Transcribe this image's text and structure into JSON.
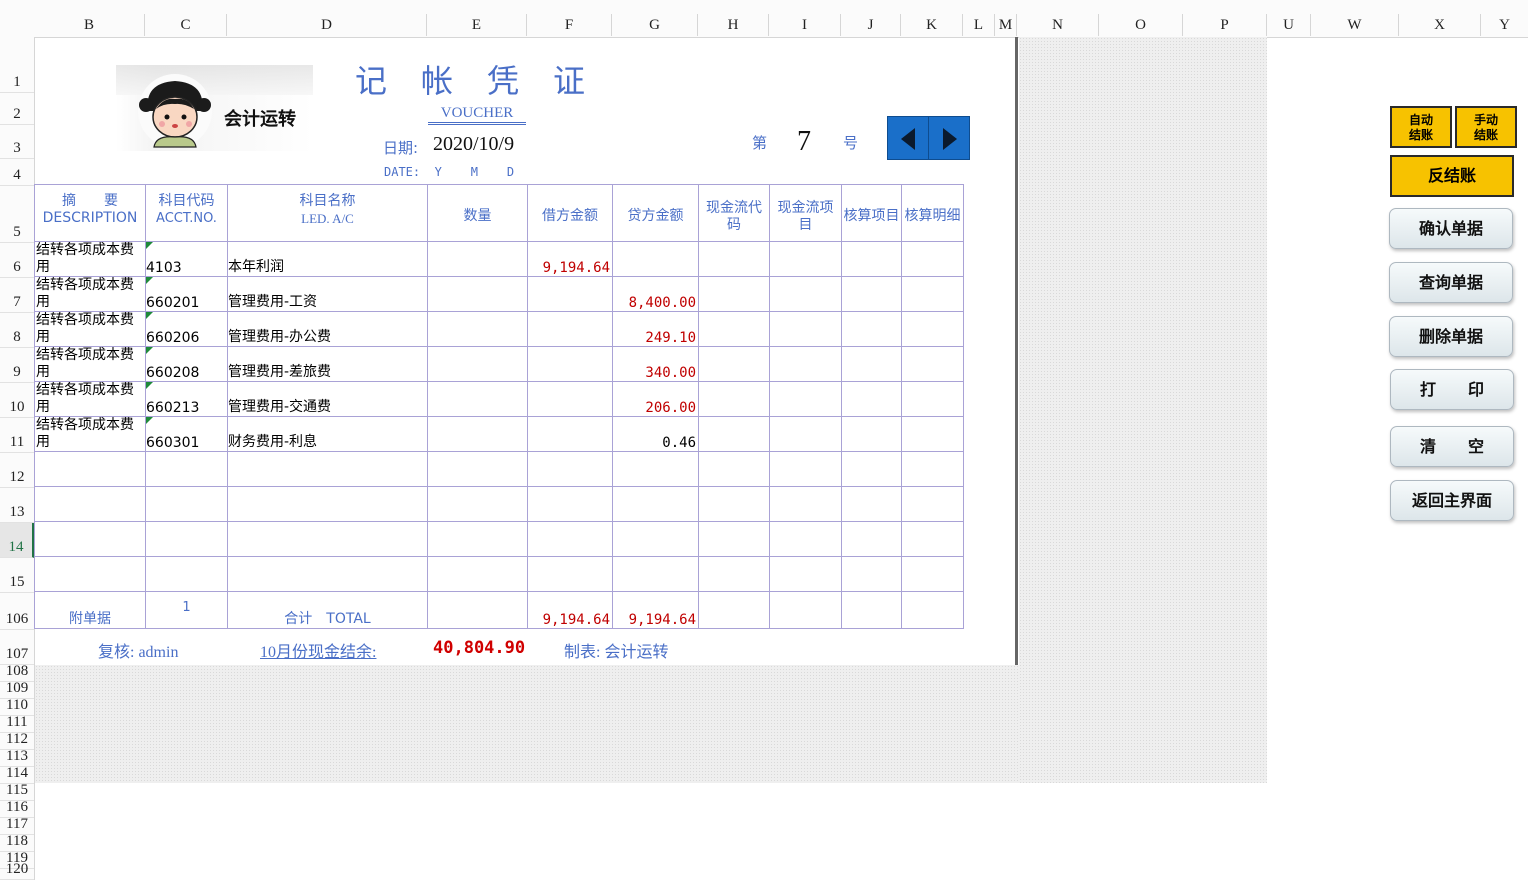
{
  "columns": [
    "B",
    "C",
    "D",
    "E",
    "F",
    "G",
    "H",
    "I",
    "J",
    "K",
    "L",
    "M",
    "N",
    "O",
    "P",
    "U",
    "W",
    "X",
    "Y"
  ],
  "rows": [
    "1",
    "2",
    "3",
    "4",
    "5",
    "6",
    "7",
    "8",
    "9",
    "10",
    "11",
    "12",
    "13",
    "14",
    "15",
    "106",
    "107",
    "108",
    "109",
    "110",
    "111",
    "112",
    "113",
    "114",
    "115",
    "116",
    "117",
    "118",
    "119",
    "120"
  ],
  "voucher": {
    "title": "记帐凭证",
    "subtitle": "VOUCHER",
    "logo_text": "会计运转",
    "date_label": "日期:",
    "date_value": "2020/10/9",
    "date_sub": "DATE:  Y    M    D",
    "no_prefix": "第",
    "no_value": "7",
    "no_suffix": "号"
  },
  "table": {
    "headers": [
      {
        "cn": "摘　　要",
        "en": "DESCRIPTION"
      },
      {
        "cn": "科目代码",
        "en": "ACCT.NO."
      },
      {
        "cn": "科目名称",
        "en": "LED. A/C"
      },
      {
        "cn": "数量",
        "en": ""
      },
      {
        "cn": "借方金额",
        "en": ""
      },
      {
        "cn": "贷方金额",
        "en": ""
      },
      {
        "cn": "现金流代码",
        "en": ""
      },
      {
        "cn": "现金流项目",
        "en": ""
      },
      {
        "cn": "核算项目",
        "en": ""
      },
      {
        "cn": "核算明细",
        "en": ""
      }
    ],
    "rows": [
      {
        "desc": "结转各项成本费用",
        "code": "4103",
        "name": "本年利润",
        "debit": "9,194.64",
        "credit": ""
      },
      {
        "desc": "结转各项成本费用",
        "code": "660201",
        "name": "管理费用-工资",
        "debit": "",
        "credit": "8,400.00"
      },
      {
        "desc": "结转各项成本费用",
        "code": "660206",
        "name": "管理费用-办公费",
        "debit": "",
        "credit": "249.10"
      },
      {
        "desc": "结转各项成本费用",
        "code": "660208",
        "name": "管理费用-差旅费",
        "debit": "",
        "credit": "340.00"
      },
      {
        "desc": "结转各项成本费用",
        "code": "660213",
        "name": "管理费用-交通费",
        "debit": "",
        "credit": "206.00"
      },
      {
        "desc": "结转各项成本费用",
        "code": "660301",
        "name": "财务费用-利息",
        "debit": "",
        "credit": "0.46"
      }
    ],
    "total": {
      "attach_label": "附单据",
      "attach_count": "1",
      "label": "合计　TOTAL",
      "debit": "9,194.64",
      "credit": "9,194.64"
    }
  },
  "footer": {
    "reviewer": "复核: admin",
    "cash_label": "10月份现金结余:",
    "cash_value": "40,804.90",
    "maker": "制表: 会计运转"
  },
  "buttons": {
    "auto_close": "自动\n结账",
    "manual_close": "手动\n结账",
    "reverse_close": "反结账",
    "confirm": "确认单据",
    "query": "查询单据",
    "delete": "删除单据",
    "print": "打　　印",
    "clear": "清　　空",
    "back": "返回主界面"
  },
  "colors": {
    "accent": "#4a6fc7",
    "credit_red": "#c00000",
    "button_yellow": "#f7c200",
    "nav_blue": "#1a6fc9"
  }
}
